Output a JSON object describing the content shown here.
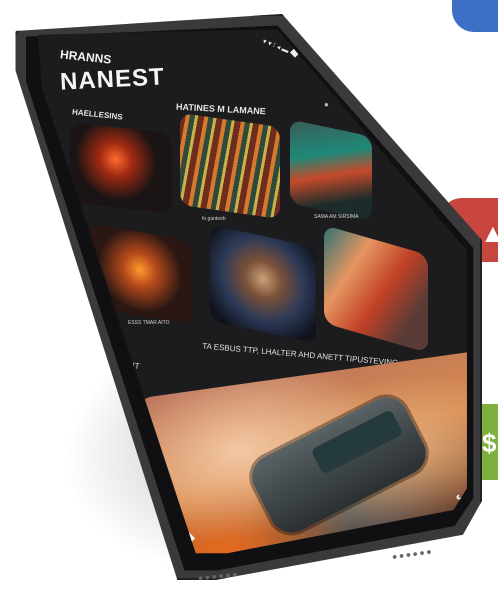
{
  "status_bar": "▾ ▾ ⁝ ◂ ▬",
  "app": {
    "kicker": "HRANNS",
    "title": "NANEST"
  },
  "header": {
    "menu_icon": "diamond-icon"
  },
  "sections": {
    "left_label": "HAELLESINS",
    "row_title": "HATINES M LAMANE"
  },
  "row1_captions": [
    "",
    "",
    "fo ganteeb",
    "SAMA AM SIRSIMA"
  ],
  "row2_captions": [
    "",
    "ESSS TMAR AITO"
  ],
  "feature": {
    "label": "VIS BIT",
    "description": "TA ESBUS TTP, LHALTER AHD ANETT TIPUSTEVING"
  },
  "nav": {
    "left_glyph": "◆",
    "right_glyph": "↪"
  },
  "grill": "••••••",
  "blobs": {
    "red_glyph": "▲",
    "green_glyph": "$"
  },
  "colors": {
    "blue": "#3d6fc4",
    "red": "#c8463e",
    "green": "#7fb03f",
    "screen": "#1c1c1e"
  }
}
